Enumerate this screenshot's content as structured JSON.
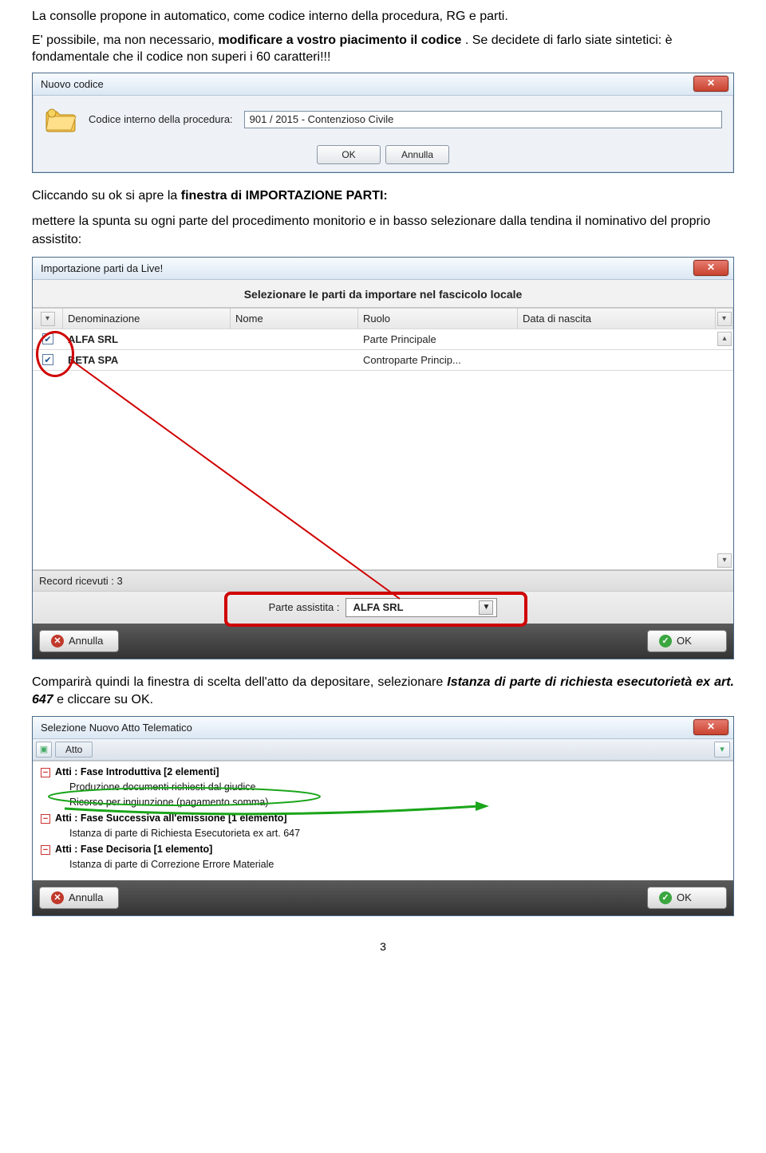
{
  "intro": {
    "p1a": "La consolle propone in automatico, come codice interno della procedura, RG e parti.",
    "p1b_prefix": "E' possibile, ma non necessario, ",
    "p1b_bold": "modificare a vostro piacimento il codice",
    "p1b_suffix": ". Se decidete di farlo siate sintetici: è fondamentale che il codice non superi i 60 caratteri!!!"
  },
  "dlg1": {
    "title": "Nuovo codice",
    "label": "Codice interno della procedura:",
    "value": "901 / 2015 - Contenzioso Civile",
    "ok": "OK",
    "cancel": "Annulla"
  },
  "mid": {
    "a": "Cliccando su ok si apre la ",
    "b_bold": "finestra di IMPORTAZIONE PARTI:",
    "c": "mettere la spunta su ogni parte del procedimento monitorio e in basso selezionare dalla tendina il nominativo del proprio assistito:"
  },
  "dlg2": {
    "title": "Importazione parti da Live!",
    "subtitle": "Selezionare le parti da importare nel fascicolo locale",
    "cols": {
      "c1": "Denominazione",
      "c2": "Nome",
      "c3": "Ruolo",
      "c4": "Data di nascita"
    },
    "rows": [
      {
        "checked": true,
        "denom": "ALFA SRL",
        "nome": "",
        "ruolo": "Parte Principale",
        "dob": ""
      },
      {
        "checked": true,
        "denom": "BETA SPA",
        "nome": "",
        "ruolo": "Controparte Princip...",
        "dob": ""
      }
    ],
    "records": "Record ricevuti : 3",
    "assist_label": "Parte assistita :",
    "assist_value": "ALFA SRL",
    "annulla": "Annulla",
    "ok": "OK"
  },
  "after2": {
    "a": "Comparirà quindi la finestra di scelta dell'atto da depositare, selezionare ",
    "b_bi": "Istanza di parte di richiesta esecutorietà ex art. 647",
    "c": " e cliccare su OK."
  },
  "dlg3": {
    "title": "Selezione Nuovo Atto Telematico",
    "tab": "Atto",
    "groups": [
      {
        "label": "Atti : Fase Introduttiva  [2 elementi]",
        "items": [
          "Produzione documenti richiesti dal giudice",
          "Ricorso per ingiunzione (pagamento somma)"
        ]
      },
      {
        "label": "Atti : Fase Successiva all'emissione  [1 elemento]",
        "items": [
          "Istanza di parte di Richiesta Esecutorieta ex art. 647"
        ]
      },
      {
        "label": "Atti : Fase Decisoria  [1 elemento]",
        "items": [
          "Istanza di parte di Correzione Errore Materiale"
        ]
      }
    ],
    "annulla": "Annulla",
    "ok": "OK"
  },
  "page_number": "3"
}
